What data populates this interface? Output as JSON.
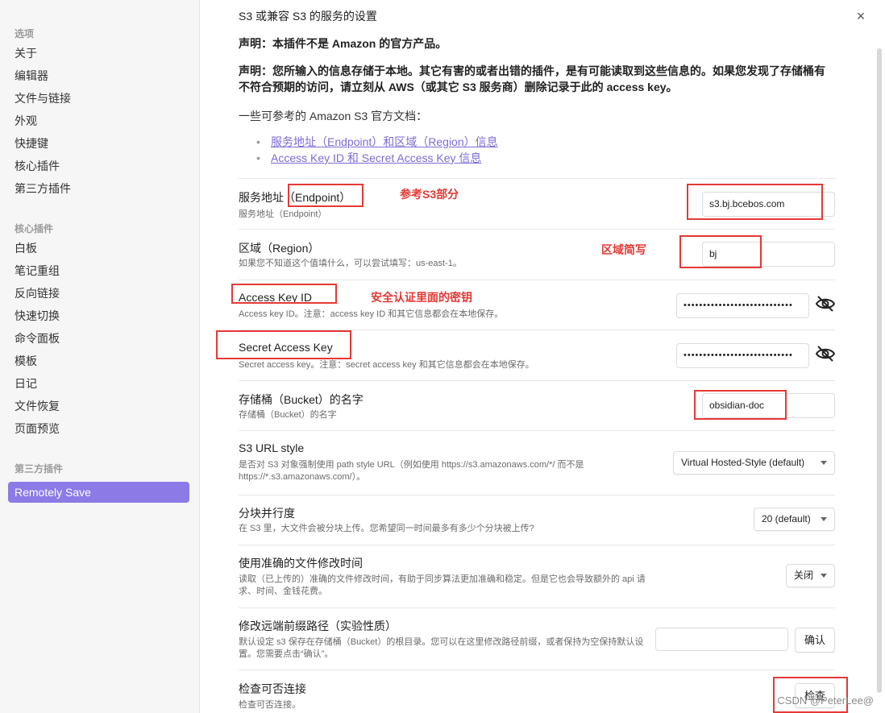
{
  "sidebar": {
    "sections": [
      {
        "title": "选项",
        "items": [
          "关于",
          "编辑器",
          "文件与链接",
          "外观",
          "快捷键",
          "核心插件",
          "第三方插件"
        ]
      },
      {
        "title": "核心插件",
        "items": [
          "白板",
          "笔记重组",
          "反向链接",
          "快速切换",
          "命令面板",
          "模板",
          "日记",
          "文件恢复",
          "页面预览"
        ]
      },
      {
        "title": "第三方插件",
        "items": [
          "Remotely Save"
        ]
      }
    ],
    "active_item": "Remotely Save"
  },
  "main": {
    "title": "S3 或兼容 S3 的服务的设置",
    "disclaimer_1": "声明：本插件不是 Amazon 的官方产品。",
    "disclaimer_2": "声明：您所输入的信息存储于本地。其它有害的或者出错的插件，是有可能读取到这些信息的。如果您发现了存储桶有不符合预期的访问，请立刻从 AWS（或其它 S3 服务商）删除记录于此的 access key。",
    "refs_intro": "一些可参考的 Amazon S3 官方文档：",
    "ref_links": [
      "服务地址（Endpoint）和区域（Region）信息",
      "Access Key ID 和 Secret Access Key 信息"
    ],
    "settings": {
      "endpoint": {
        "name": "服务地址（Endpoint）",
        "desc": "服务地址（Endpoint）",
        "value": "s3.bj.bcebos.com"
      },
      "region": {
        "name": "区域（Region）",
        "desc": "如果您不知道这个值填什么，可以尝试填写：us-east-1。",
        "value": "bj"
      },
      "access_key": {
        "name": "Access Key ID",
        "desc": "Access key ID。注意：access key ID 和其它信息都会在本地保存。",
        "value": "••••••••••••••••••••••••••••"
      },
      "secret_key": {
        "name": "Secret Access Key",
        "desc": "Secret access key。注意：secret access key 和其它信息都会在本地保存。",
        "value": "••••••••••••••••••••••••••••"
      },
      "bucket": {
        "name": "存储桶（Bucket）的名字",
        "desc": "存储桶（Bucket）的名字",
        "value": "obsidian-doc"
      },
      "url_style": {
        "name": "S3 URL style",
        "desc": "是否对 S3 对象强制使用 path style URL（例如使用 https://s3.amazonaws.com/*/ 而不是 https://*.s3.amazonaws.com/）。",
        "value": "Virtual Hosted-Style (default)"
      },
      "parallel": {
        "name": "分块并行度",
        "desc": "在 S3 里，大文件会被分块上传。您希望同一时间最多有多少个分块被上传?",
        "value": "20 (default)"
      },
      "accurate_mtime": {
        "name": "使用准确的文件修改时间",
        "desc": "读取（已上传的）准确的文件修改时间，有助于同步算法更加准确和稳定。但是它也会导致额外的 api 请求、时间、金钱花费。",
        "value": "关闭"
      },
      "prefix": {
        "name": "修改远端前缀路径（实验性质）",
        "desc": "默认设定 s3 保存在存储桶（Bucket）的根目录。您可以在这里修改路径前缀，或者保持为空保持默认设置。您需要点击“确认”。",
        "value": "",
        "button": "确认"
      },
      "check": {
        "name": "检查可否连接",
        "desc": "检查可否连接。",
        "button": "检查"
      }
    }
  },
  "annotations": {
    "endpoint_note": "参考S3部分",
    "region_note": "区域简写",
    "access_note": "安全认证里面的密钥"
  },
  "watermark": "CSDN @PeterLee@",
  "close_icon": "×",
  "colors": {
    "accent": "#8c7ae6",
    "annotation": "#e53935",
    "link": "#7e6bd6"
  }
}
